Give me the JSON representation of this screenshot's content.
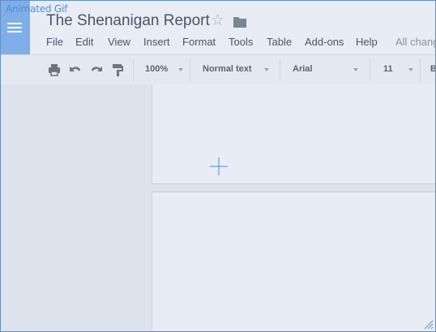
{
  "overlay": {
    "label": "Animated Gif"
  },
  "header": {
    "title": "The Shenanigan Report",
    "save_status": "All chang"
  },
  "menu": {
    "items": [
      "File",
      "Edit",
      "View",
      "Insert",
      "Format",
      "Tools",
      "Table",
      "Add-ons",
      "Help"
    ]
  },
  "toolbar": {
    "zoom": "100%",
    "style": "Normal text",
    "font": "Arial",
    "size": "11",
    "bold": "B"
  },
  "icons": {
    "logo": "docs-menu-icon",
    "star": "star-icon",
    "folder": "folder-icon",
    "print": "print-icon",
    "undo": "undo-icon",
    "redo": "redo-icon",
    "paint_format": "paint-format-icon",
    "cursor": "crosshair-cursor-icon"
  },
  "colors": {
    "logo_bg": "#7faee9",
    "frame_border": "#5f8fc8",
    "label": "#4a8fd8"
  }
}
